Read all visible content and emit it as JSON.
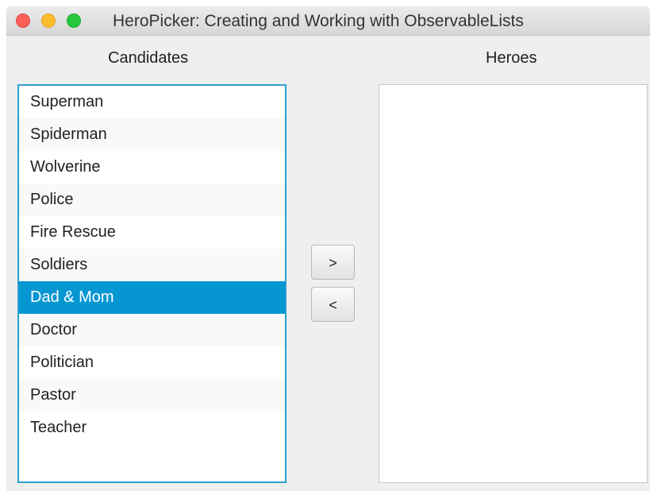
{
  "window": {
    "title": "HeroPicker: Creating and Working with ObservableLists"
  },
  "candidates": {
    "label": "Candidates",
    "items": [
      "Superman",
      "Spiderman",
      "Wolverine",
      "Police",
      "Fire Rescue",
      "Soldiers",
      "Dad & Mom",
      "Doctor",
      "Politician",
      "Pastor",
      "Teacher"
    ],
    "selected_index": 6
  },
  "heroes": {
    "label": "Heroes",
    "items": []
  },
  "buttons": {
    "add_label": ">",
    "remove_label": "<"
  },
  "colors": {
    "selection": "#0696d1",
    "focus_border": "#2d9fd0",
    "close": "#fc5f57",
    "minimize": "#fdbc2e",
    "maximize": "#27c840"
  }
}
